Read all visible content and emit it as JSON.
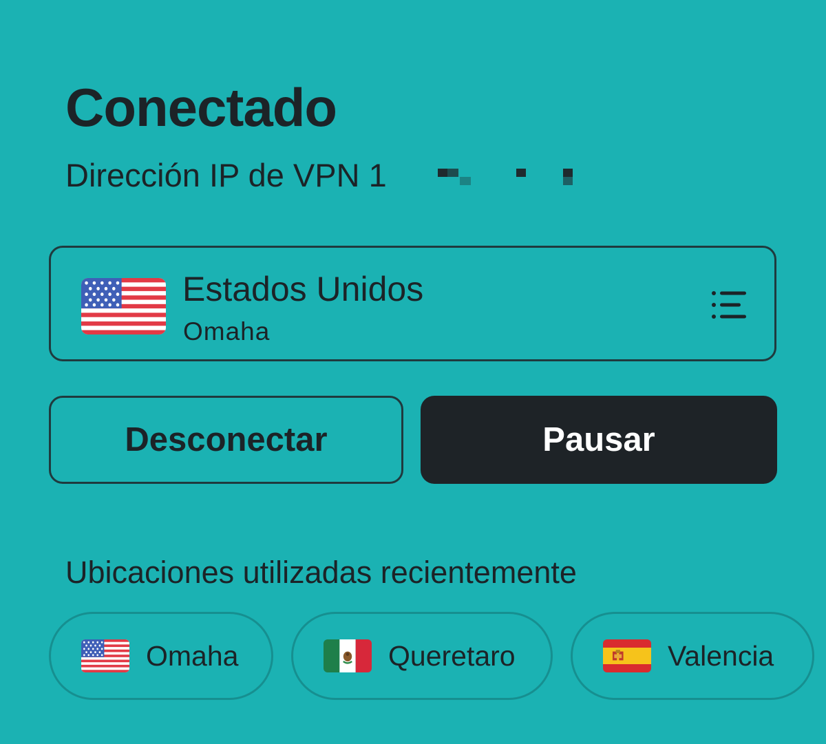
{
  "status": {
    "title": "Conectado",
    "ip_label": "Dirección IP de VPN 1"
  },
  "location": {
    "country": "Estados Unidos",
    "city": "Omaha",
    "flag_icon": "us-flag-icon",
    "menu_icon": "list-icon"
  },
  "actions": {
    "disconnect_label": "Desconectar",
    "pause_label": "Pausar"
  },
  "recent": {
    "heading": "Ubicaciones utilizadas recientemente",
    "items": [
      {
        "label": "Omaha",
        "flag_icon": "us-flag-icon"
      },
      {
        "label": "Queretaro",
        "flag_icon": "mexico-flag-icon"
      },
      {
        "label": "Valencia",
        "flag_icon": "spain-flag-icon"
      }
    ]
  },
  "colors": {
    "background": "#1bb2b3",
    "text": "#1c2327",
    "primary_button": "#1e2327",
    "primary_button_text": "#ffffff"
  }
}
